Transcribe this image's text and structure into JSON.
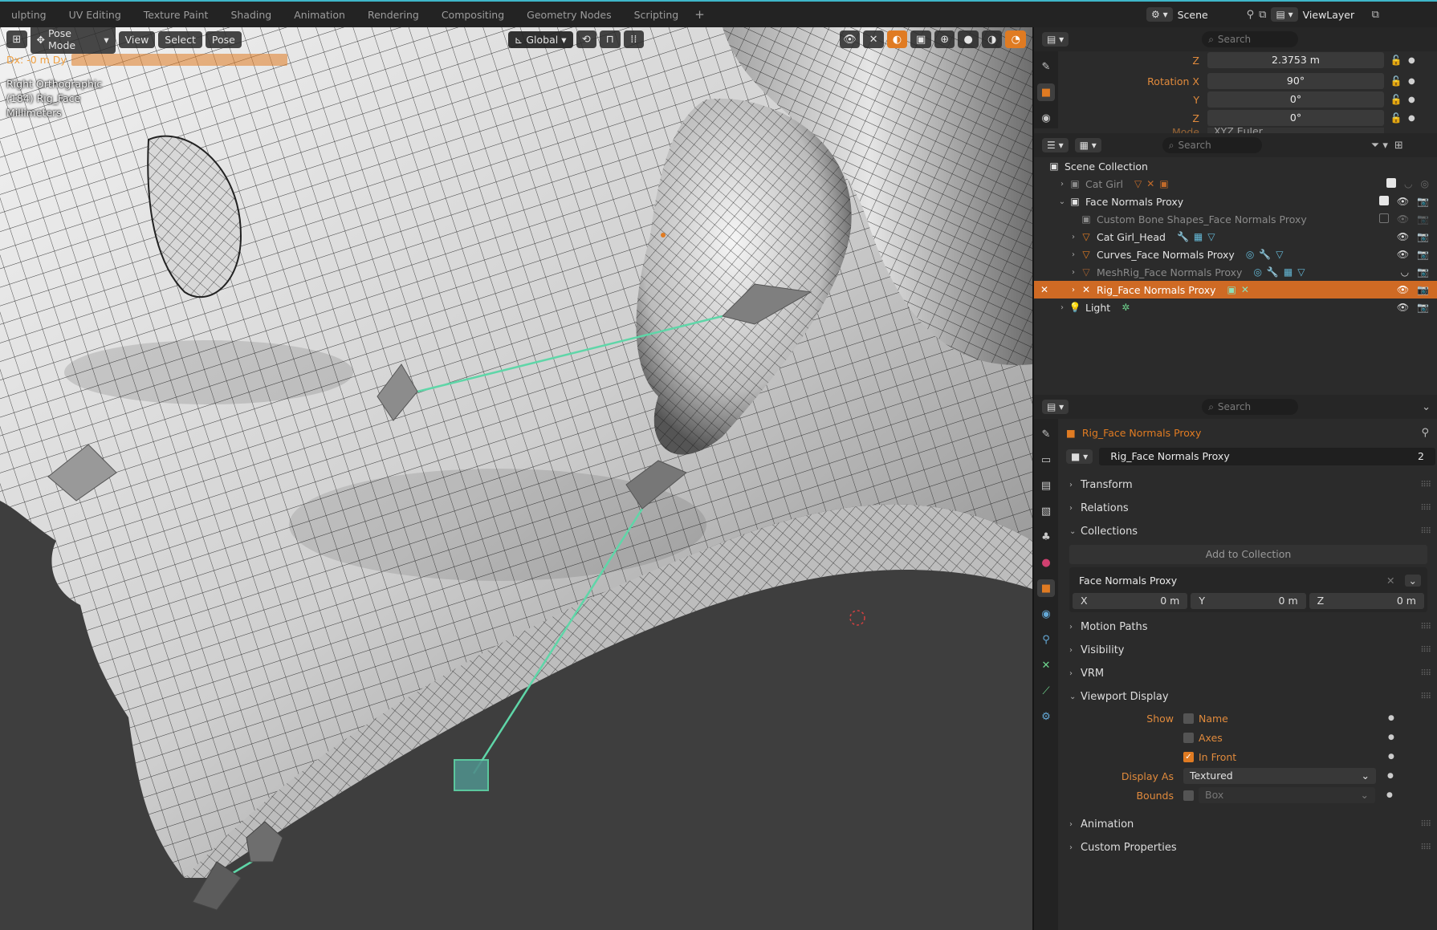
{
  "workspaces": [
    "ulpting",
    "UV Editing",
    "Texture Paint",
    "Shading",
    "Animation",
    "Rendering",
    "Compositing",
    "Geometry Nodes",
    "Scripting"
  ],
  "workspace_add": "+",
  "scene": {
    "name": "Scene",
    "view_layer": "ViewLayer"
  },
  "viewport": {
    "mode": "Pose Mode",
    "menus": [
      "View",
      "Select",
      "Pose"
    ],
    "orientation": "Global",
    "delta": "Dx: -0 m   Dy",
    "view_name": "Right Orthographic",
    "object_info": "(184) Rig_Face",
    "units": "Millimeters"
  },
  "transform_panel": {
    "search_placeholder": "Search",
    "z_label": "Z",
    "z_value": "2.3753 m",
    "rotation_label": "Rotation X",
    "rotation_x": "90°",
    "y_label": "Y",
    "rotation_y": "0°",
    "rz_label": "Z",
    "rotation_z": "0°",
    "mode_label": "Mode",
    "mode_value": "XYZ Euler"
  },
  "outliner": {
    "search_placeholder": "Search",
    "root": "Scene Collection",
    "items": [
      {
        "name": "Cat Girl",
        "dim": true
      },
      {
        "name": "Face Normals Proxy"
      },
      {
        "name": "Custom Bone Shapes_Face Normals Proxy",
        "dim": true
      },
      {
        "name": "Cat Girl_Head"
      },
      {
        "name": "Curves_Face Normals Proxy"
      },
      {
        "name": "MeshRig_Face Normals Proxy",
        "dim": true
      },
      {
        "name": "Rig_Face Normals Proxy",
        "selected": true
      },
      {
        "name": "Light"
      }
    ]
  },
  "properties": {
    "search_placeholder": "Search",
    "object_title": "Rig_Face Normals Proxy",
    "object_name": "Rig_Face Normals Proxy",
    "user_count": "2",
    "sections": {
      "transform": "Transform",
      "relations": "Relations",
      "collections": "Collections",
      "motion_paths": "Motion Paths",
      "visibility": "Visibility",
      "vrm": "VRM",
      "viewport_display": "Viewport Display",
      "animation": "Animation",
      "custom_properties": "Custom Properties"
    },
    "add_to_collection": "Add to Collection",
    "collection_name": "Face Normals Proxy",
    "offset": {
      "x_label": "X",
      "x": "0 m",
      "y_label": "Y",
      "y": "0 m",
      "z_label": "Z",
      "z": "0 m"
    },
    "viewport_display": {
      "show_label": "Show",
      "name": "Name",
      "axes": "Axes",
      "in_front": "In Front",
      "display_as_label": "Display As",
      "display_as": "Textured",
      "bounds_label": "Bounds",
      "bounds": "Box"
    }
  },
  "colors": {
    "accent": "#e07b22",
    "selection": "#cf6a24",
    "bone_line": "#5fd6a8",
    "topbar_line": "#3fb6c9"
  }
}
